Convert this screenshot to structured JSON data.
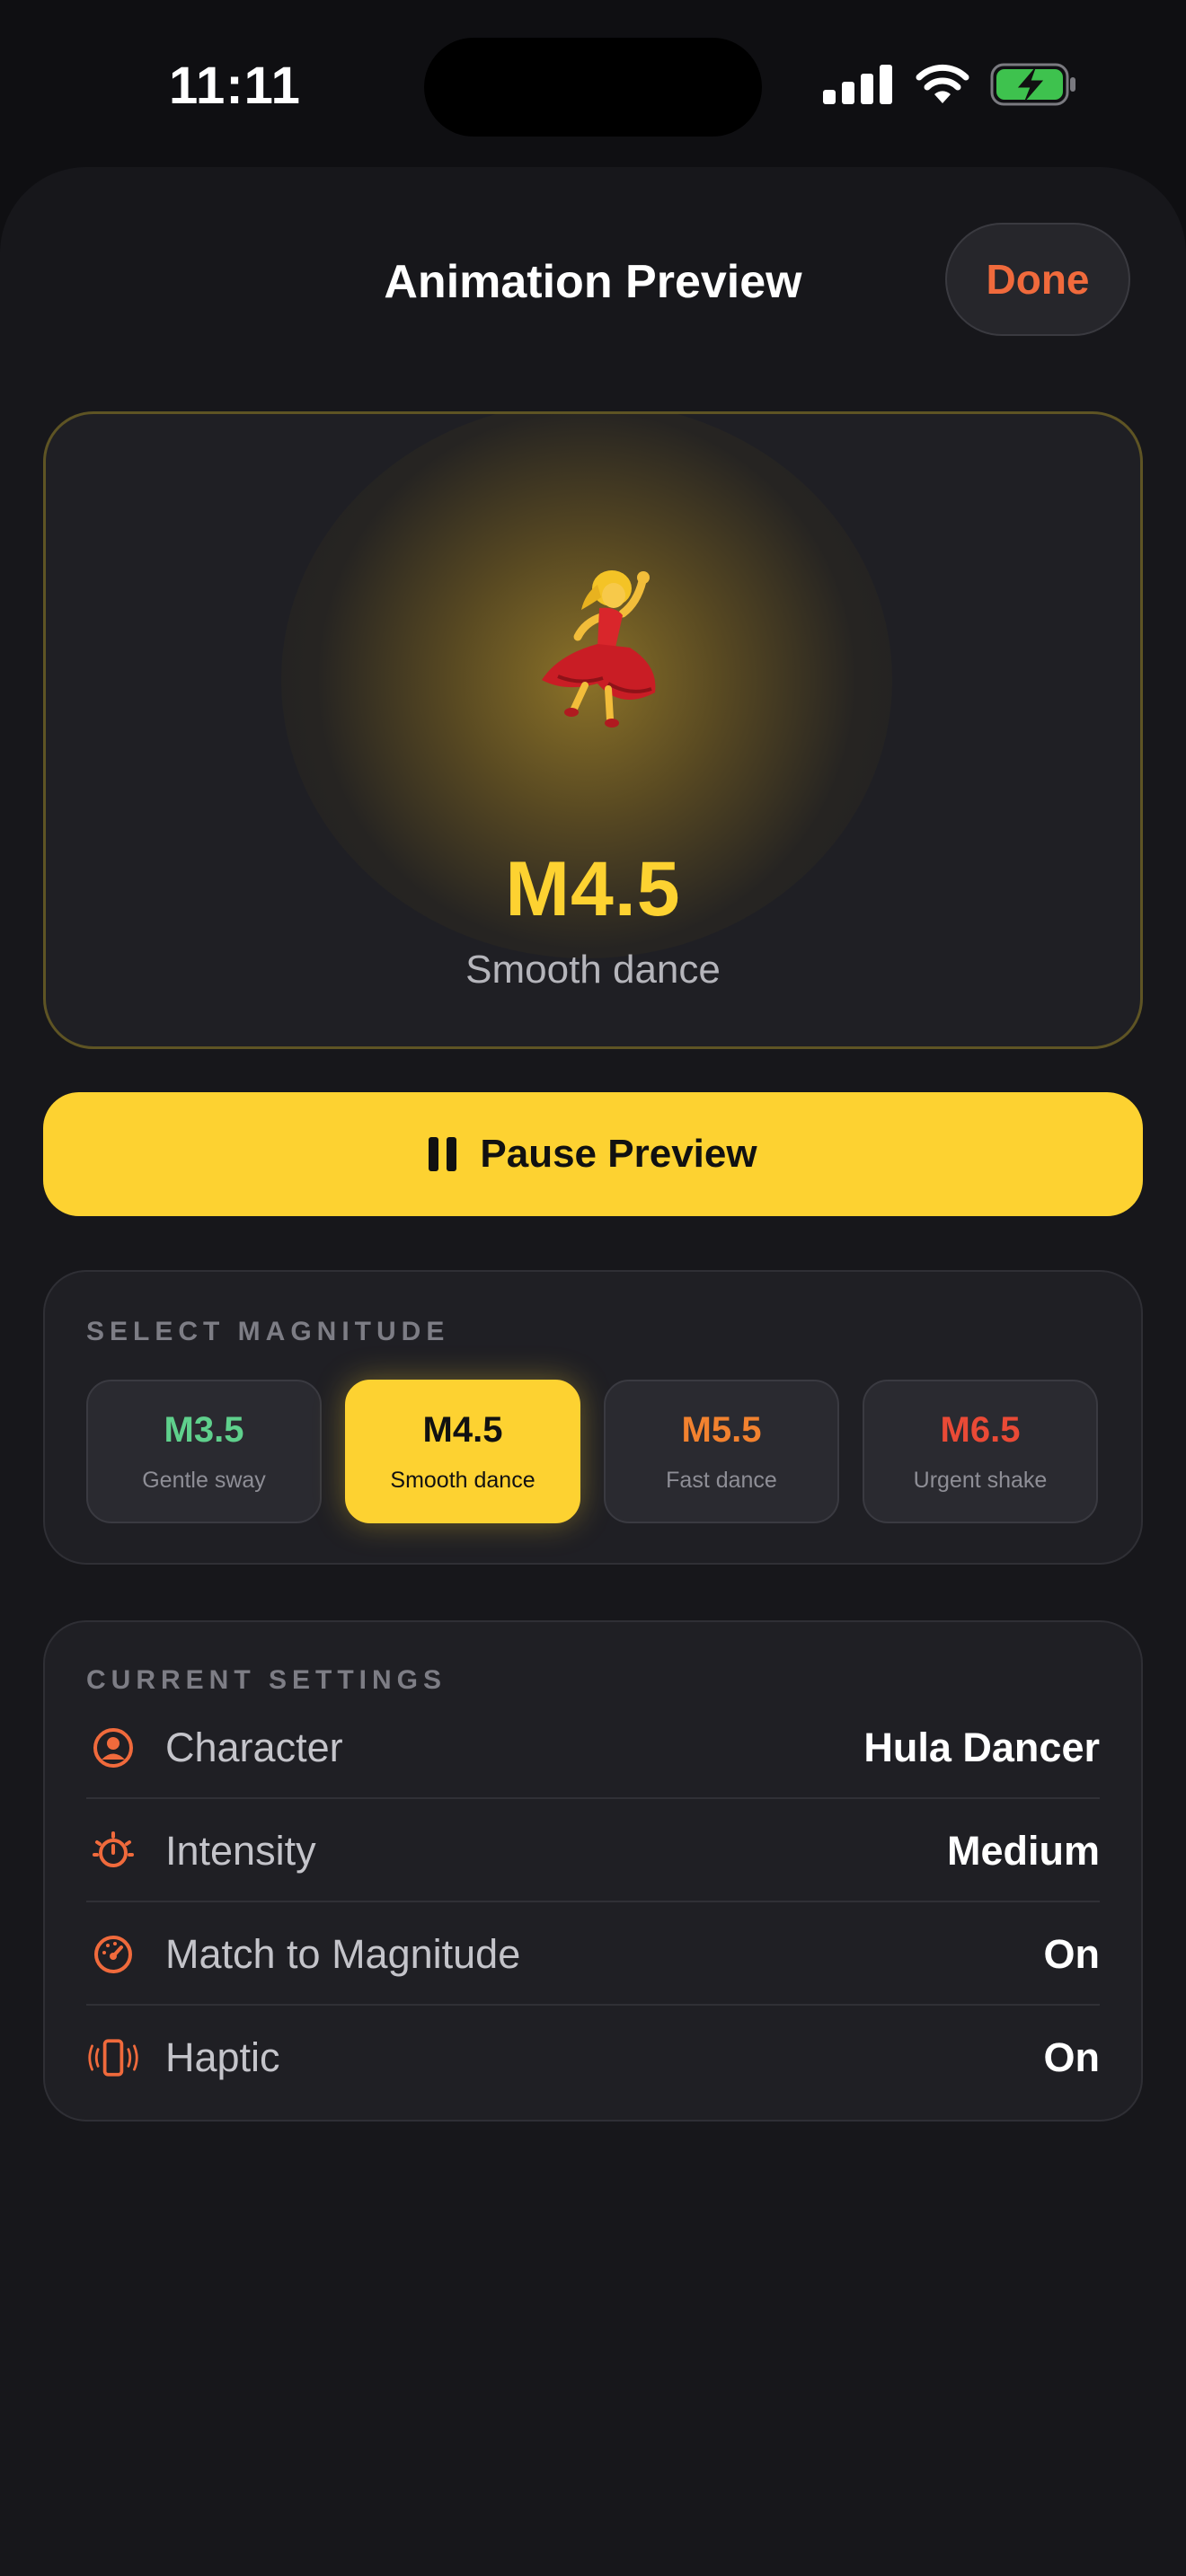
{
  "status_bar": {
    "time": "11:11"
  },
  "header": {
    "title": "Animation Preview",
    "done_label": "Done"
  },
  "preview": {
    "magnitude": "M4.5",
    "description": "Smooth dance",
    "character_icon": "dancer-emoji"
  },
  "play_button": {
    "label": "Pause Preview",
    "icon": "pause-icon"
  },
  "magnitude_selector": {
    "section_label": "SELECT MAGNITUDE",
    "options": [
      {
        "value": "M3.5",
        "label": "Gentle sway",
        "color": "#5fd08c",
        "selected": false
      },
      {
        "value": "M4.5",
        "label": "Smooth dance",
        "color": "#111111",
        "selected": true
      },
      {
        "value": "M5.5",
        "label": "Fast dance",
        "color": "#f2822f",
        "selected": false
      },
      {
        "value": "M6.5",
        "label": "Urgent shake",
        "color": "#ea4a36",
        "selected": false
      }
    ]
  },
  "settings": {
    "section_label": "CURRENT SETTINGS",
    "rows": [
      {
        "label": "Character",
        "value": "Hula Dancer",
        "icon": "person-circle-icon"
      },
      {
        "label": "Intensity",
        "value": "Medium",
        "icon": "timer-icon"
      },
      {
        "label": "Match to Magnitude",
        "value": "On",
        "icon": "gauge-icon"
      },
      {
        "label": "Haptic",
        "value": "On",
        "icon": "phone-vibrate-icon"
      }
    ]
  },
  "colors": {
    "accent": "#fdd231",
    "orange": "#f06a3c",
    "background": "#0f0f12",
    "card": "#1f1f24"
  }
}
